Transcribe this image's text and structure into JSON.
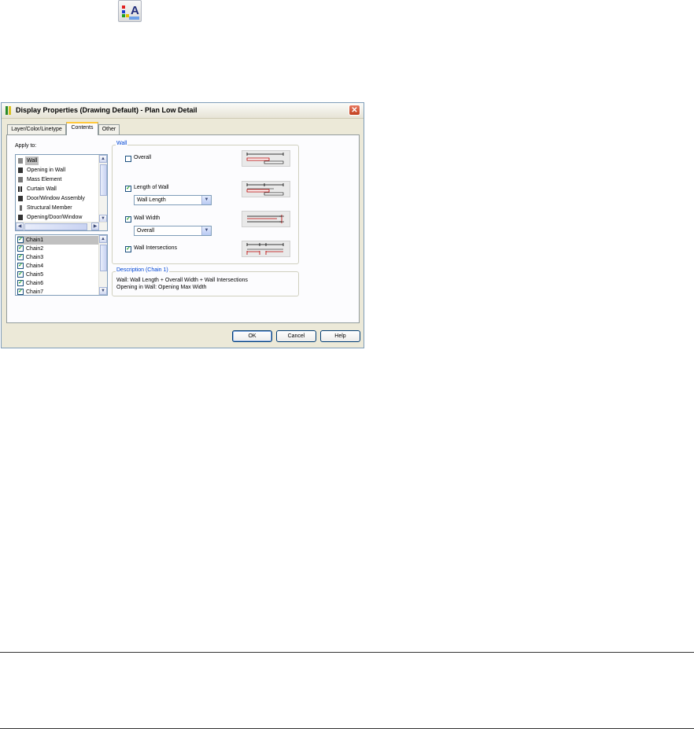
{
  "toolbar_icon": {
    "name": "display-properties-icon"
  },
  "dialog": {
    "title": "Display Properties (Drawing Default) - Plan Low Detail",
    "tabs": [
      {
        "label": "Layer/Color/Linetype"
      },
      {
        "label": "Contents",
        "active": true
      },
      {
        "label": "Other"
      }
    ],
    "apply_to": {
      "label": "Apply to:",
      "items": [
        {
          "label": "Wall",
          "selected": true
        },
        {
          "label": "Opening in Wall"
        },
        {
          "label": "Mass Element"
        },
        {
          "label": "Curtain Wall"
        },
        {
          "label": "Door/Window Assembly"
        },
        {
          "label": "Structural Member"
        },
        {
          "label": "Opening/Door/Window"
        }
      ]
    },
    "chains": {
      "items": [
        {
          "label": "Chain1",
          "checked": true,
          "selected": true
        },
        {
          "label": "Chain2",
          "checked": true
        },
        {
          "label": "Chain3",
          "checked": true
        },
        {
          "label": "Chain4",
          "checked": true
        },
        {
          "label": "Chain5",
          "checked": true
        },
        {
          "label": "Chain6",
          "checked": true
        },
        {
          "label": "Chain7",
          "checked": true
        }
      ]
    },
    "wall_group": {
      "label": "Wall",
      "overall": {
        "label": "Overall",
        "checked": false
      },
      "length_of_wall": {
        "label": "Length of Wall",
        "checked": true,
        "combo_value": "Wall Length"
      },
      "wall_width": {
        "label": "Wall Width",
        "checked": true,
        "combo_value": "Overall"
      },
      "wall_intersections": {
        "label": "Wall Intersections",
        "checked": true
      }
    },
    "description": {
      "label": "Description (Chain 1)",
      "line1": "Wall: Wall Length + Overall Width + Wall Intersections",
      "line2": "Opening in Wall: Opening Max Width"
    },
    "buttons": {
      "ok": "OK",
      "cancel": "Cancel",
      "help": "Help"
    },
    "colors": {
      "accent_tab": "#ffc83c",
      "group_label": "#0046d5",
      "check": "#21a121",
      "close": "#c1401f"
    }
  }
}
